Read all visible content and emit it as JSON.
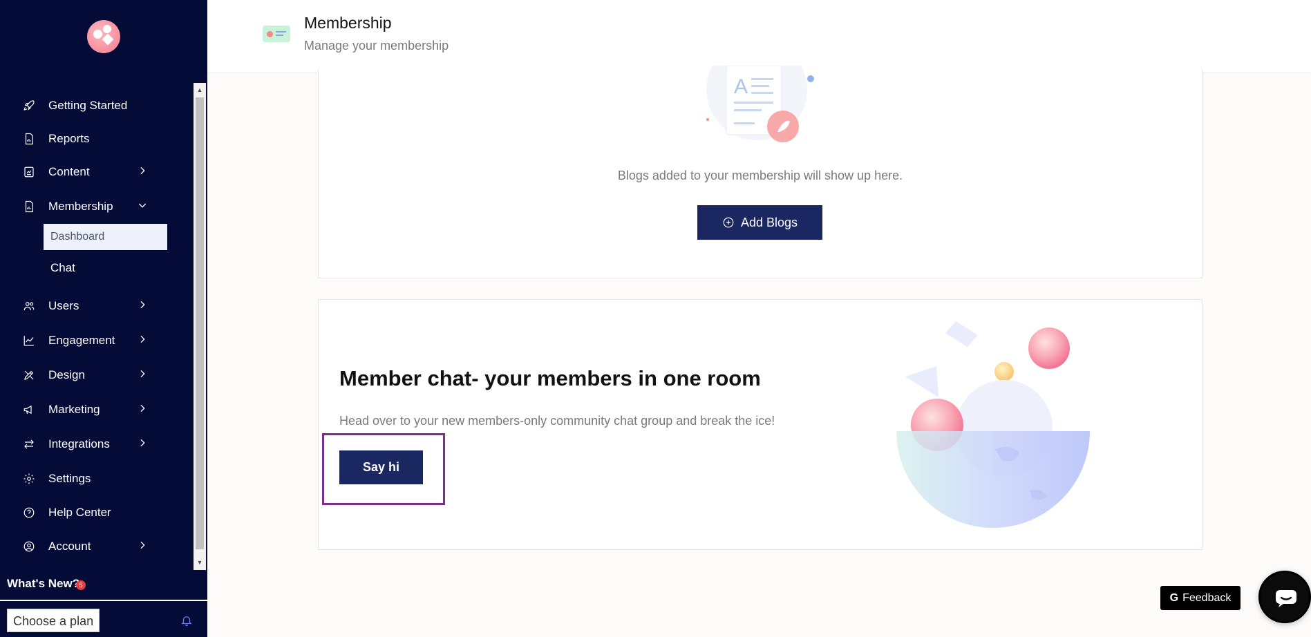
{
  "header": {
    "title": "Membership",
    "subtitle": "Manage your membership"
  },
  "sidebar": {
    "items": [
      {
        "label": "Getting Started",
        "icon": "rocket-icon"
      },
      {
        "label": "Reports",
        "icon": "report-icon"
      },
      {
        "label": "Content",
        "icon": "content-icon",
        "expandable": true
      },
      {
        "label": "Membership",
        "icon": "membership-icon",
        "expanded": true
      },
      {
        "label": "Users",
        "icon": "users-icon",
        "expandable": true
      },
      {
        "label": "Engagement",
        "icon": "chart-icon",
        "expandable": true
      },
      {
        "label": "Design",
        "icon": "design-icon",
        "expandable": true
      },
      {
        "label": "Marketing",
        "icon": "megaphone-icon",
        "expandable": true
      },
      {
        "label": "Integrations",
        "icon": "arrows-icon",
        "expandable": true
      },
      {
        "label": "Settings",
        "icon": "gear-icon"
      },
      {
        "label": "Help Center",
        "icon": "help-icon"
      },
      {
        "label": "Account",
        "icon": "account-icon",
        "expandable": true
      }
    ],
    "submenu": {
      "active": "Dashboard",
      "other": "Chat"
    },
    "whats_new": "What's New?",
    "whats_new_badge": "5",
    "choose_plan": "Choose a plan"
  },
  "blogs": {
    "empty_text": "Blogs added to your membership will show up here.",
    "add_button": "Add Blogs"
  },
  "chat": {
    "title": "Member chat- your members in one room",
    "description": "Head over to your new members-only community chat group and break the ice!",
    "button": "Say hi"
  },
  "feedback_label": "Feedback",
  "colors": {
    "sidebar_bg": "#050b37",
    "primary_button": "#1a2760",
    "highlight_border": "#7b2d8b"
  }
}
